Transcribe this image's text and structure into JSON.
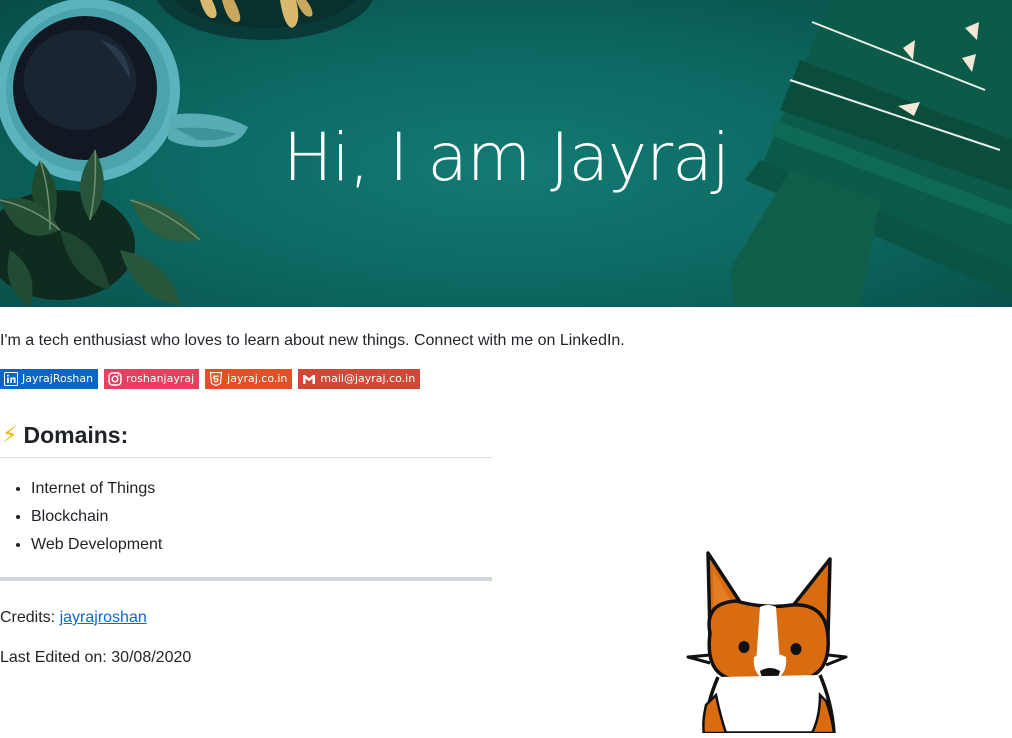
{
  "hero": {
    "title": "Hi, I am Jayraj"
  },
  "intro": {
    "text": "I'm a tech enthusiast who loves to learn about new things. Connect with me on LinkedIn."
  },
  "badges": [
    {
      "label": "JayrajRoshan",
      "icon": "linkedin-icon",
      "color": "#0A66C2"
    },
    {
      "label": "roshanjayraj",
      "icon": "instagram-icon",
      "color": "#E4405F"
    },
    {
      "label": "jayraj.co.in",
      "icon": "html5-icon",
      "color": "#E34F26"
    },
    {
      "label": "mail@jayraj.co.in",
      "icon": "gmail-icon",
      "color": "#D14836"
    }
  ],
  "domains": {
    "emoji": "⚡",
    "heading": "Domains:",
    "items": [
      "Internet of Things",
      "Blockchain",
      "Web Development"
    ]
  },
  "credits": {
    "label": "Credits:",
    "link_text": "jayrajroshan"
  },
  "last_edited": {
    "text": "Last Edited on: 30/08/2020"
  }
}
